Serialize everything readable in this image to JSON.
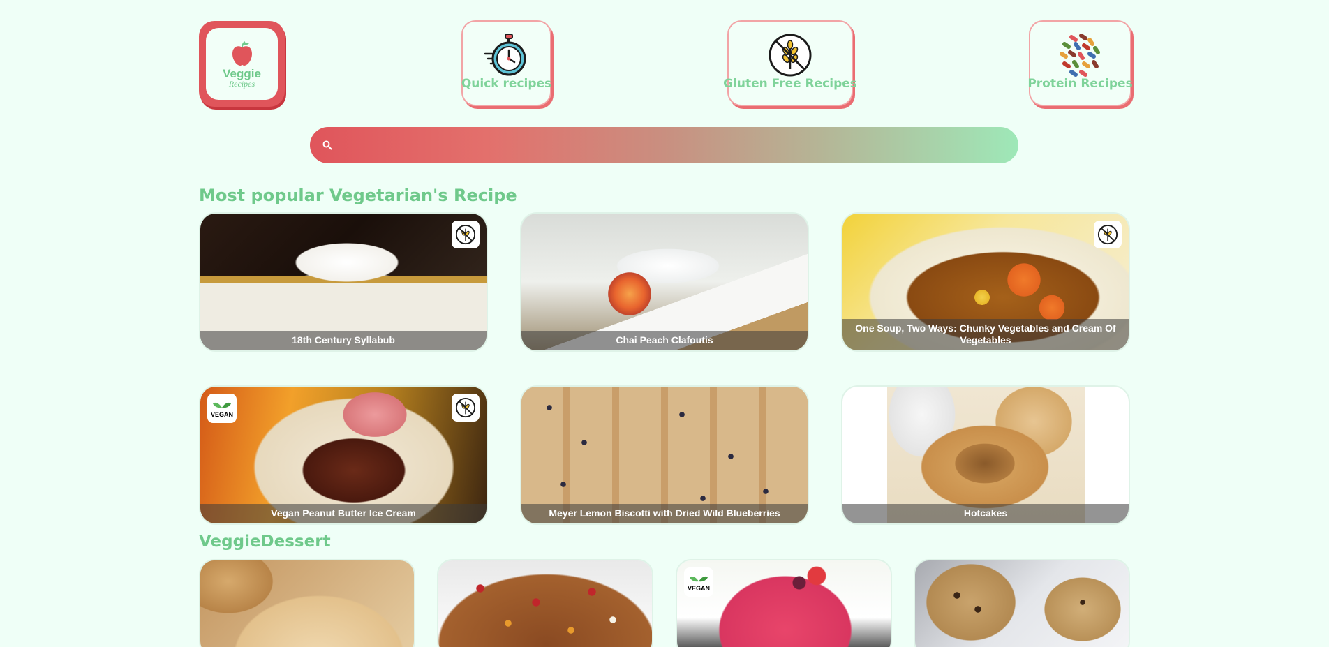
{
  "brand": {
    "word": "Veggie",
    "sub": "Recipes"
  },
  "nav": {
    "quick": "Quick recipes",
    "gluten_free": "Gluten Free Recipes",
    "protein": "Protein Recipes"
  },
  "search": {
    "placeholder": "",
    "value": ""
  },
  "popular": {
    "title": "Most popular Vegetarian's Recipe",
    "recipes": [
      {
        "title": "18th Century Syllabub",
        "gluten_free": true,
        "vegan": false
      },
      {
        "title": "Chai Peach Clafoutis",
        "gluten_free": false,
        "vegan": false
      },
      {
        "title": "One Soup, Two Ways: Chunky Vegetables and Cream Of Vegetables",
        "gluten_free": true,
        "vegan": false
      },
      {
        "title": "Vegan Peanut Butter Ice Cream",
        "gluten_free": true,
        "vegan": true
      },
      {
        "title": "Meyer Lemon Biscotti with Dried Wild Blueberries",
        "gluten_free": false,
        "vegan": false
      },
      {
        "title": "Hotcakes",
        "gluten_free": false,
        "vegan": false
      }
    ]
  },
  "dessert": {
    "title": "VeggieDessert",
    "badges": {
      "vegan": "VEGAN"
    }
  },
  "colors": {
    "background": "#effff7",
    "accent_red": "#e0555b",
    "accent_green": "#6fc98b"
  }
}
